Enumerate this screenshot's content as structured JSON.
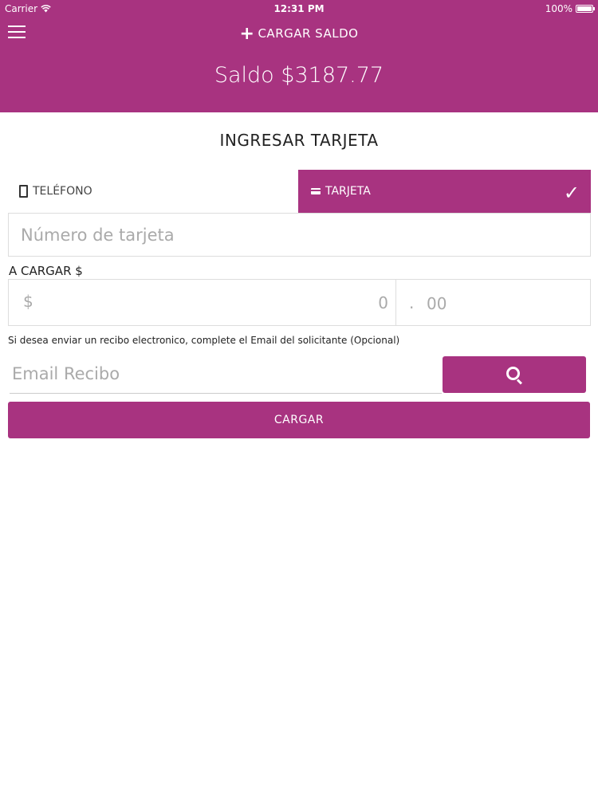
{
  "status_bar": {
    "carrier": "Carrier",
    "time": "12:31 PM",
    "battery": "100%"
  },
  "header": {
    "menu_icon": "hamburger-menu-icon",
    "action_label": "CARGAR SALDO",
    "action_icon": "plus-icon",
    "balance": "Saldo $3187.77"
  },
  "main": {
    "title": "INGRESAR TARJETA",
    "tabs": [
      {
        "label": "TELÉFONO",
        "icon": "phone-icon",
        "selected": false
      },
      {
        "label": "TARJETA",
        "icon": "credit-card-icon",
        "selected": true
      }
    ],
    "card_number": {
      "placeholder": "Número de tarjeta",
      "value": ""
    },
    "amount": {
      "label": "A CARGAR $",
      "currency": "$",
      "integer_placeholder": "0",
      "separator": ".",
      "decimal_placeholder": "00"
    },
    "email": {
      "note": "Si desea enviar un recibo electronico, complete el Email del solicitante (Opcional)",
      "placeholder": "Email Recibo",
      "value": "",
      "search_icon": "search-icon"
    },
    "submit_label": "CARGAR"
  },
  "colors": {
    "accent": "#a83380",
    "background": "#ffffff",
    "border": "#dddddd"
  }
}
